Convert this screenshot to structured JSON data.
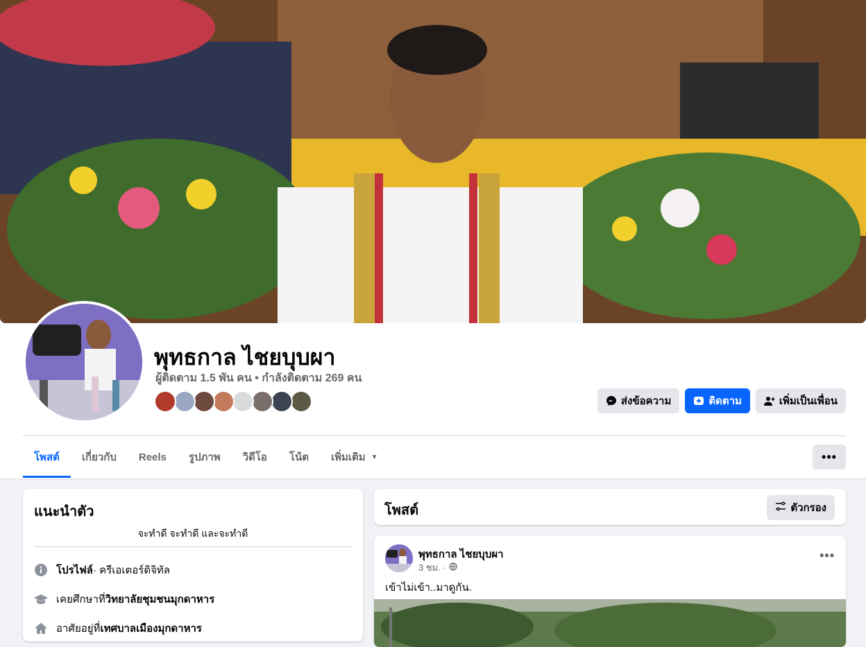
{
  "profile": {
    "name": "พุทธกาล ไชยบุบผา",
    "followers_text": "ผู้ติดตาม 1.5 พัน คน • กำลังติดตาม 269 คน",
    "mutual_colors": [
      "#b23a2a",
      "#9aa7c2",
      "#6d4a3d",
      "#c47b5c",
      "#d9dadc",
      "#7a6f6a",
      "#3b4450",
      "#5a5a45"
    ]
  },
  "actions": {
    "message_label": "ส่งข้อความ",
    "follow_label": "ติดตาม",
    "add_friend_label": "เพิ่มเป็นเพื่อน"
  },
  "tabs": [
    {
      "label": "โพสต์"
    },
    {
      "label": "เกี่ยวกับ"
    },
    {
      "label": "Reels"
    },
    {
      "label": "รูปภาพ"
    },
    {
      "label": "วิดีโอ"
    },
    {
      "label": "โน้ต"
    },
    {
      "label": "เพิ่มเติม"
    }
  ],
  "intro": {
    "title": "แนะนำตัว",
    "bio": "จะทำดี จะทำดี และจะทำดี",
    "profile_label": "โปรไฟล์",
    "profile_value": " · ครีเอเตอร์ดิจิทัล",
    "studied_prefix": "เคยศึกษาที่ ",
    "studied_value": "วิทยาลัยชุมชนมุกดาหาร",
    "lives_prefix": "อาศัยอยู่ที่ ",
    "lives_value": "เทศบาลเมืองมุกดาหาร"
  },
  "posts_section": {
    "title": "โพสต์",
    "filter_label": "ตัวกรอง"
  },
  "post": {
    "author": "พุทธกาล ไชยบุบผา",
    "time": "3 ชม. ·",
    "text": "เข้าไม่เข้า..มาดูกัน."
  },
  "colors": {
    "accent": "#0866ff",
    "secondary_text": "#65676b",
    "button_bg": "#e4e6eb"
  }
}
